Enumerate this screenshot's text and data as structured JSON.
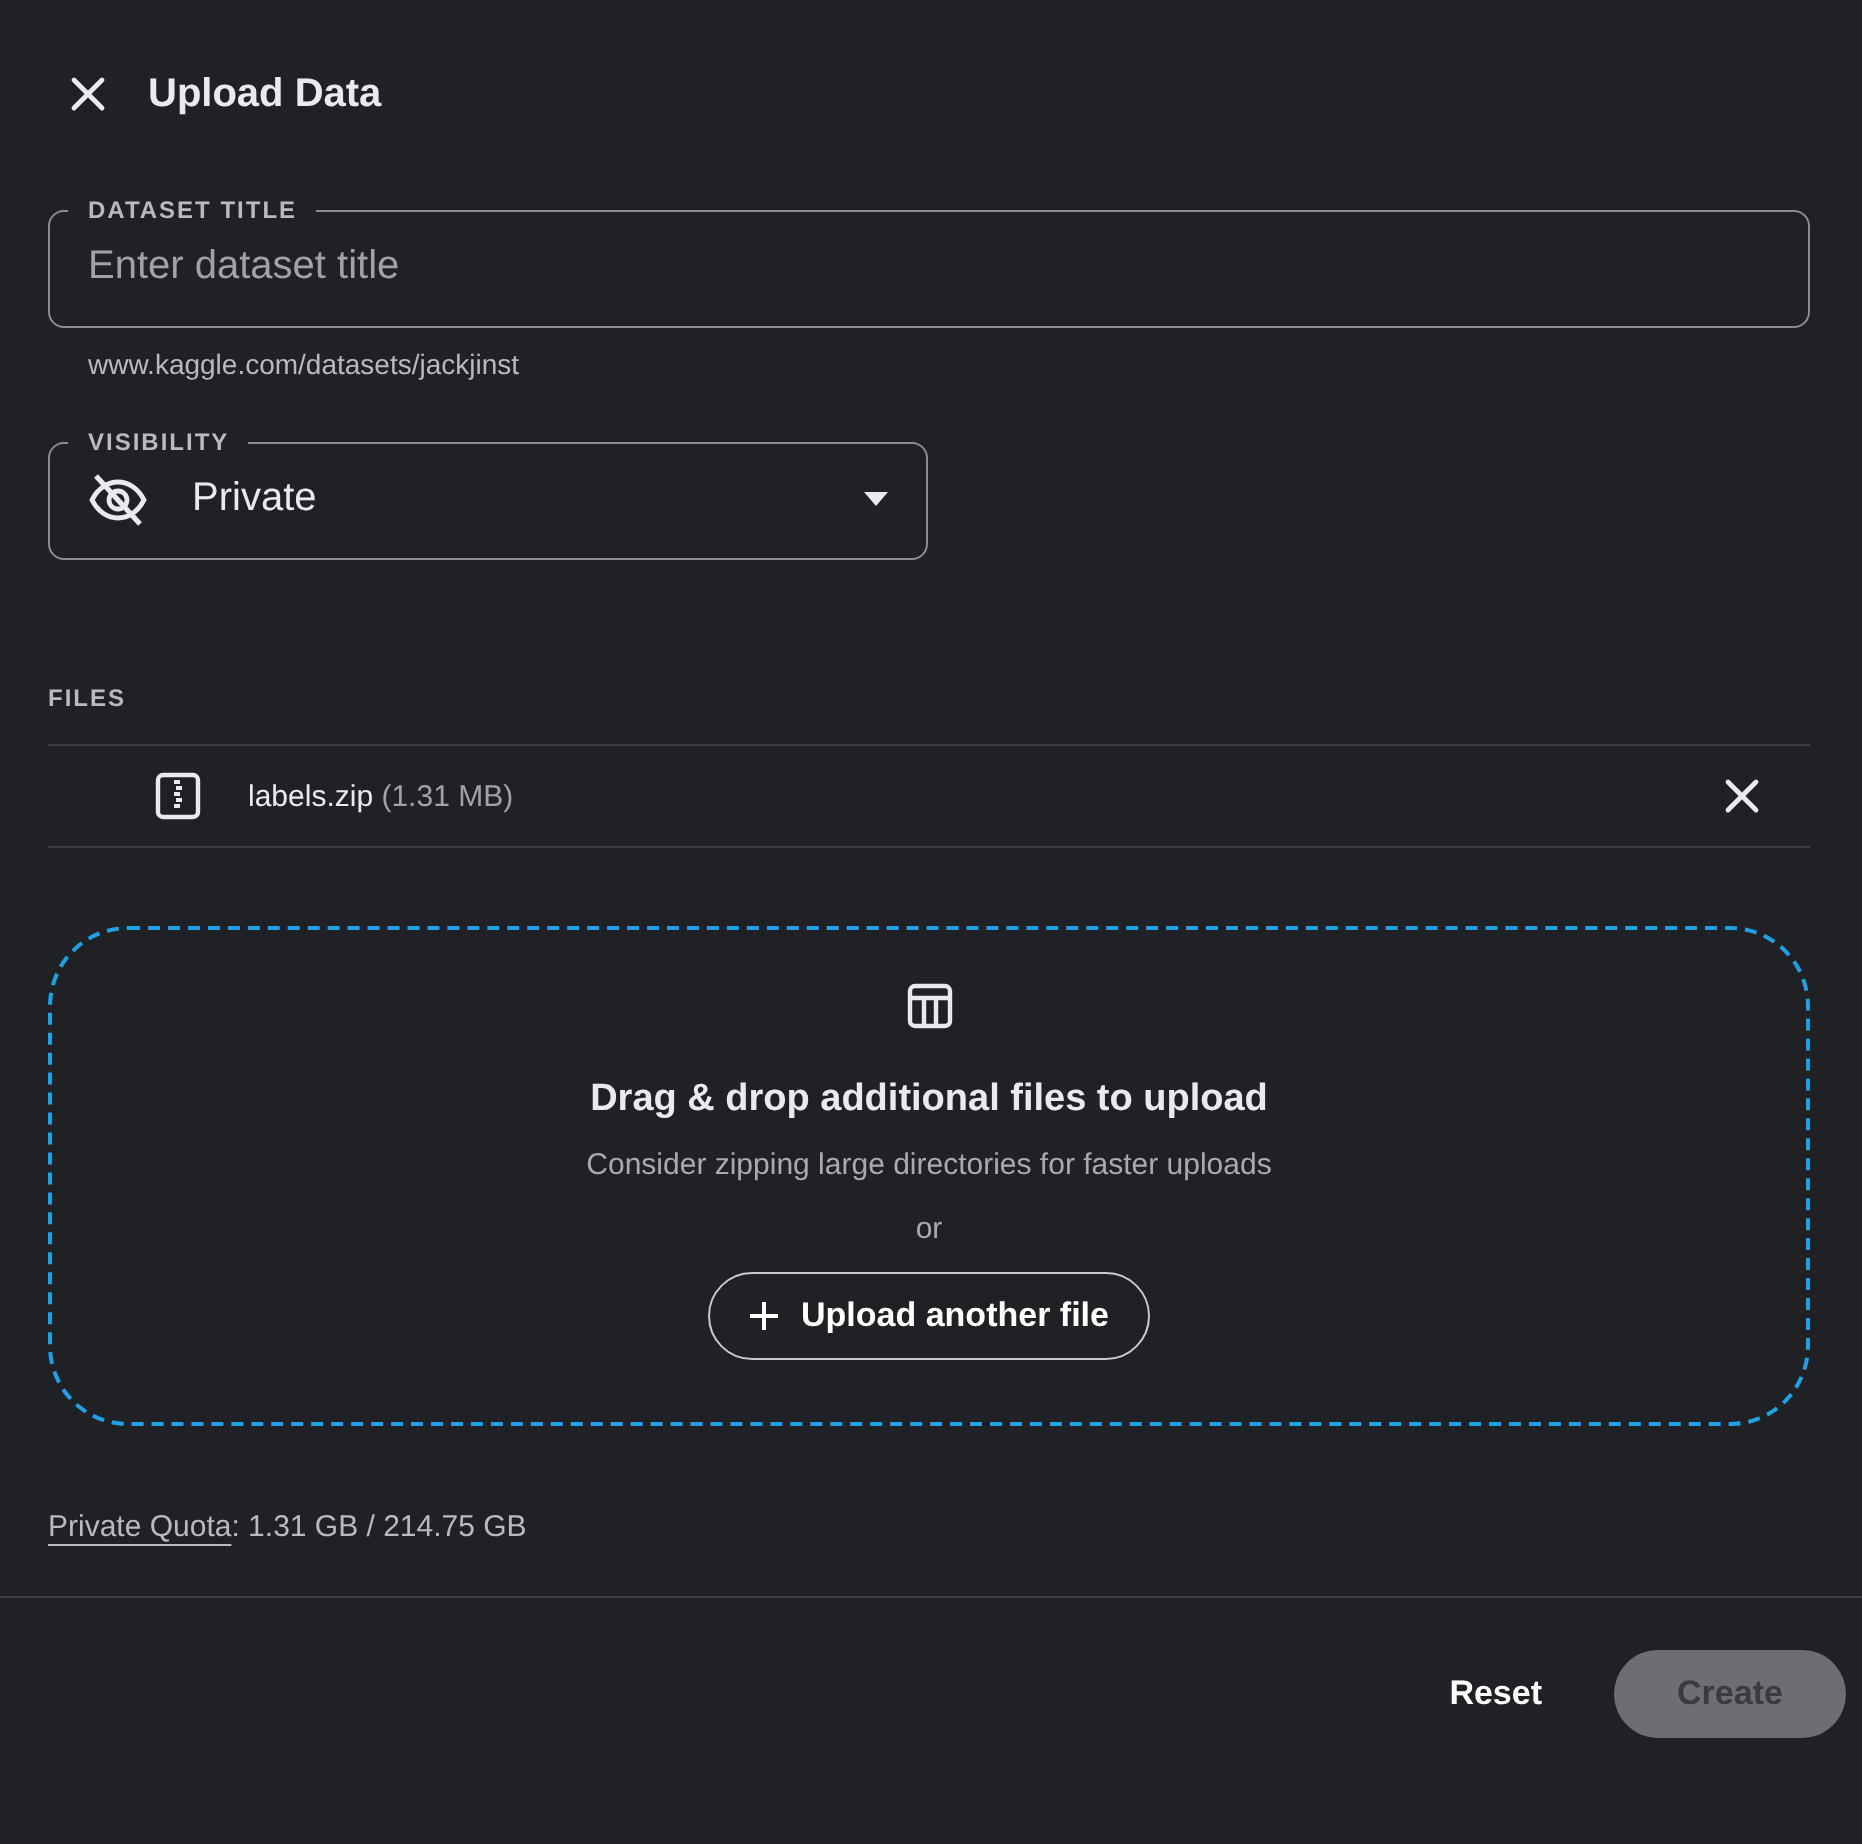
{
  "header": {
    "title": "Upload Data"
  },
  "title_field": {
    "label": "DATASET TITLE",
    "placeholder": "Enter dataset title",
    "helper": "www.kaggle.com/datasets/jackjinst"
  },
  "visibility": {
    "label": "VISIBILITY",
    "value": "Private"
  },
  "files": {
    "heading": "FILES",
    "items": [
      {
        "name": "labels.zip",
        "size": "(1.31 MB)"
      }
    ]
  },
  "dropzone": {
    "heading": "Drag & drop additional files to upload",
    "hint": "Consider zipping large directories for faster uploads",
    "or": "or",
    "button": "Upload another file"
  },
  "quota": {
    "link": "Private Quota",
    "value": ": 1.31 GB / 214.75 GB"
  },
  "footer": {
    "buttons": [
      {
        "label": "Reset",
        "kind": "text",
        "disabled": false
      },
      {
        "label": "Create",
        "kind": "filled",
        "disabled": true
      }
    ]
  }
}
